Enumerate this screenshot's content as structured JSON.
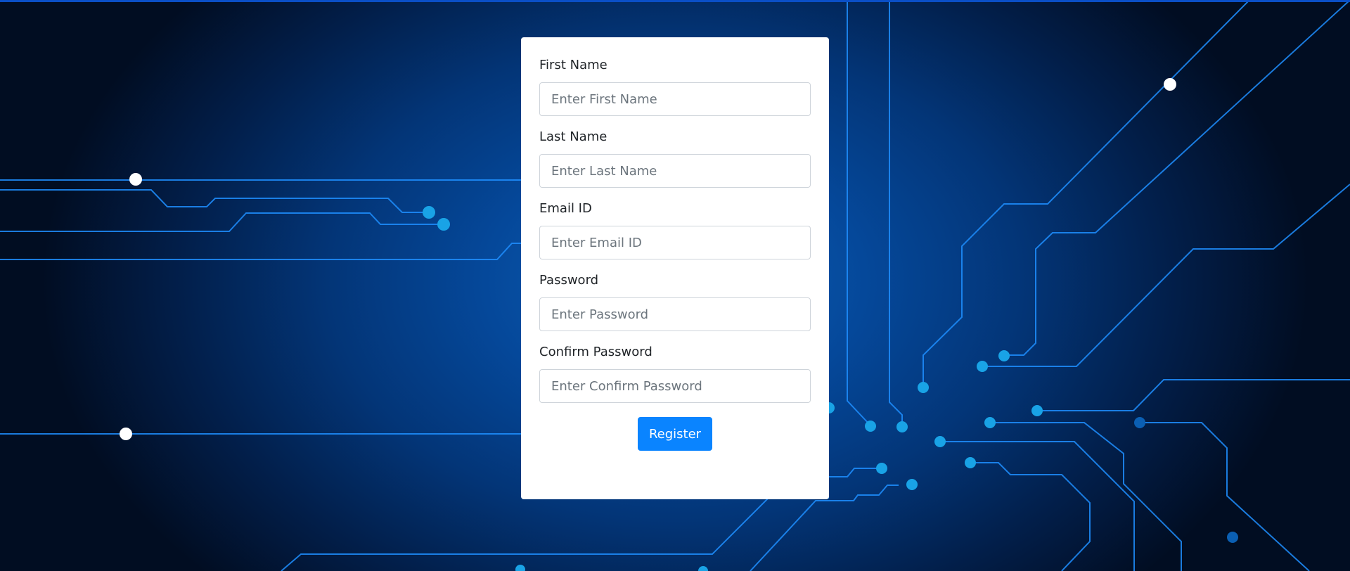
{
  "form": {
    "fields": [
      {
        "label": "First Name",
        "placeholder": "Enter First Name",
        "value": ""
      },
      {
        "label": "Last Name",
        "placeholder": "Enter Last Name",
        "value": ""
      },
      {
        "label": "Email ID",
        "placeholder": "Enter Email ID",
        "value": ""
      },
      {
        "label": "Password",
        "placeholder": "Enter Password",
        "value": ""
      },
      {
        "label": "Confirm Password",
        "placeholder": "Enter Confirm Password",
        "value": ""
      }
    ],
    "submit_label": "Register"
  },
  "colors": {
    "accent": "#0a84ff",
    "background": "#05489a",
    "circuit_line": "#1f8fff",
    "circuit_node": "#19a3e6"
  }
}
